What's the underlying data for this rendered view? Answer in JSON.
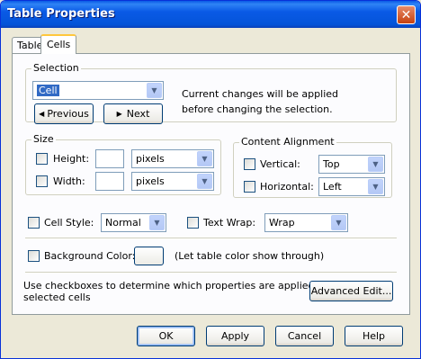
{
  "window": {
    "title": "Table Properties",
    "close_icon": "close-icon"
  },
  "tabs": [
    {
      "label": "Table"
    },
    {
      "label": "Cells"
    }
  ],
  "selection": {
    "label": "Selection",
    "dropdown_value": "Cell",
    "previous_label": "Previous",
    "next_label": "Next",
    "note_line1": "Current changes will be applied",
    "note_line2": "before changing the selection."
  },
  "size": {
    "label": "Size",
    "height_label": "Height:",
    "height_value": "",
    "height_unit": "pixels",
    "width_label": "Width:",
    "width_value": "",
    "width_unit": "pixels"
  },
  "alignment": {
    "label": "Content Alignment",
    "vertical_label": "Vertical:",
    "vertical_value": "Top",
    "horizontal_label": "Horizontal:",
    "horizontal_value": "Left"
  },
  "cell_style": {
    "label": "Cell Style:",
    "value": "Normal"
  },
  "text_wrap": {
    "label": "Text Wrap:",
    "value": "Wrap"
  },
  "background": {
    "label": "Background Color:",
    "note": "(Let table color show through)"
  },
  "footer_note": {
    "line1": "Use checkboxes to determine which properties are applied to all",
    "line2": "selected cells"
  },
  "advanced_edit_label": "Advanced Edit...",
  "buttons": {
    "ok": "OK",
    "apply": "Apply",
    "cancel": "Cancel",
    "help": "Help"
  },
  "colors": {
    "titlebar": "#0a5ae6",
    "selection_highlight": "#316ac5",
    "tab_accent": "#ffc73c"
  }
}
